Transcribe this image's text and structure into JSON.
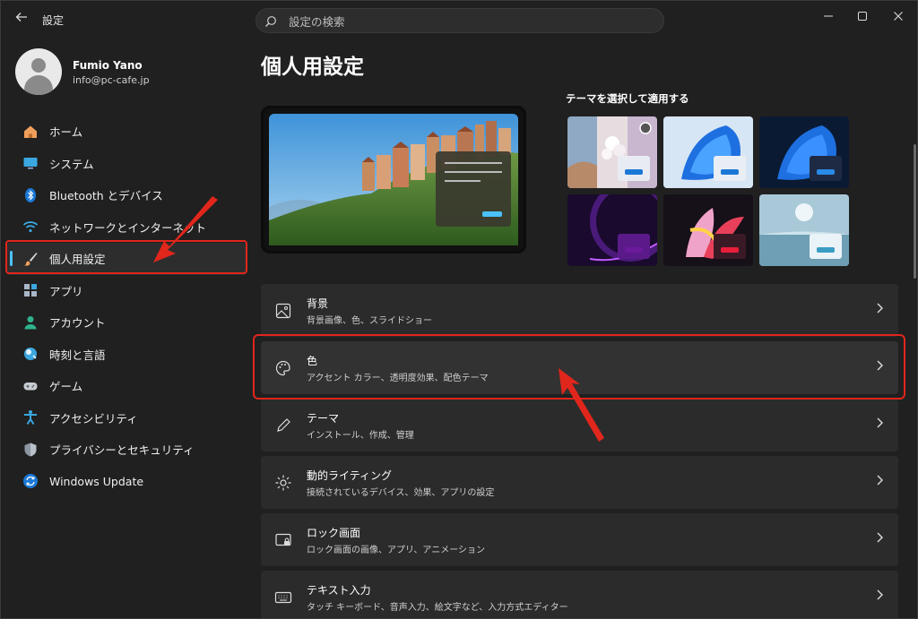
{
  "window": {
    "title": "設定",
    "back_icon": "back-arrow-icon",
    "min_icon": "minimize-icon",
    "max_icon": "maximize-icon",
    "close_icon": "close-icon"
  },
  "search": {
    "placeholder": "設定の検索"
  },
  "user": {
    "name": "Fumio Yano",
    "email": "info@pc-cafe.jp"
  },
  "sidebar": {
    "items": [
      {
        "label": "ホーム",
        "icon": "home-icon"
      },
      {
        "label": "システム",
        "icon": "system-icon"
      },
      {
        "label": "Bluetooth とデバイス",
        "icon": "bluetooth-icon"
      },
      {
        "label": "ネットワークとインターネット",
        "icon": "network-icon"
      },
      {
        "label": "個人用設定",
        "icon": "brush-icon",
        "active": true
      },
      {
        "label": "アプリ",
        "icon": "apps-icon"
      },
      {
        "label": "アカウント",
        "icon": "account-icon"
      },
      {
        "label": "時刻と言語",
        "icon": "time-language-icon"
      },
      {
        "label": "ゲーム",
        "icon": "gaming-icon"
      },
      {
        "label": "アクセシビリティ",
        "icon": "accessibility-icon"
      },
      {
        "label": "プライバシーとセキュリティ",
        "icon": "shield-icon"
      },
      {
        "label": "Windows Update",
        "icon": "update-icon"
      }
    ]
  },
  "main": {
    "title": "個人用設定",
    "themes_label": "テーマを選択して適用する",
    "cards": [
      {
        "title": "背景",
        "subtitle": "背景画像、色、スライドショー",
        "icon": "picture-icon"
      },
      {
        "title": "色",
        "subtitle": "アクセント カラー、透明度効果、配色テーマ",
        "icon": "palette-icon"
      },
      {
        "title": "テーマ",
        "subtitle": "インストール、作成、管理",
        "icon": "pen-icon"
      },
      {
        "title": "動的ライティング",
        "subtitle": "接続されているデバイス、効果、アプリの設定",
        "icon": "lighting-icon"
      },
      {
        "title": "ロック画面",
        "subtitle": "ロック画面の画像、アプリ、アニメーション",
        "icon": "lock-screen-icon"
      },
      {
        "title": "テキスト入力",
        "subtitle": "タッチ キーボード、音声入力、絵文字など、入力方式エディター",
        "icon": "keyboard-icon"
      }
    ]
  },
  "colors": {
    "accent": "#4cc2ff",
    "annotation": "#e1261c",
    "background": "#202020",
    "card": "#2b2b2b"
  }
}
